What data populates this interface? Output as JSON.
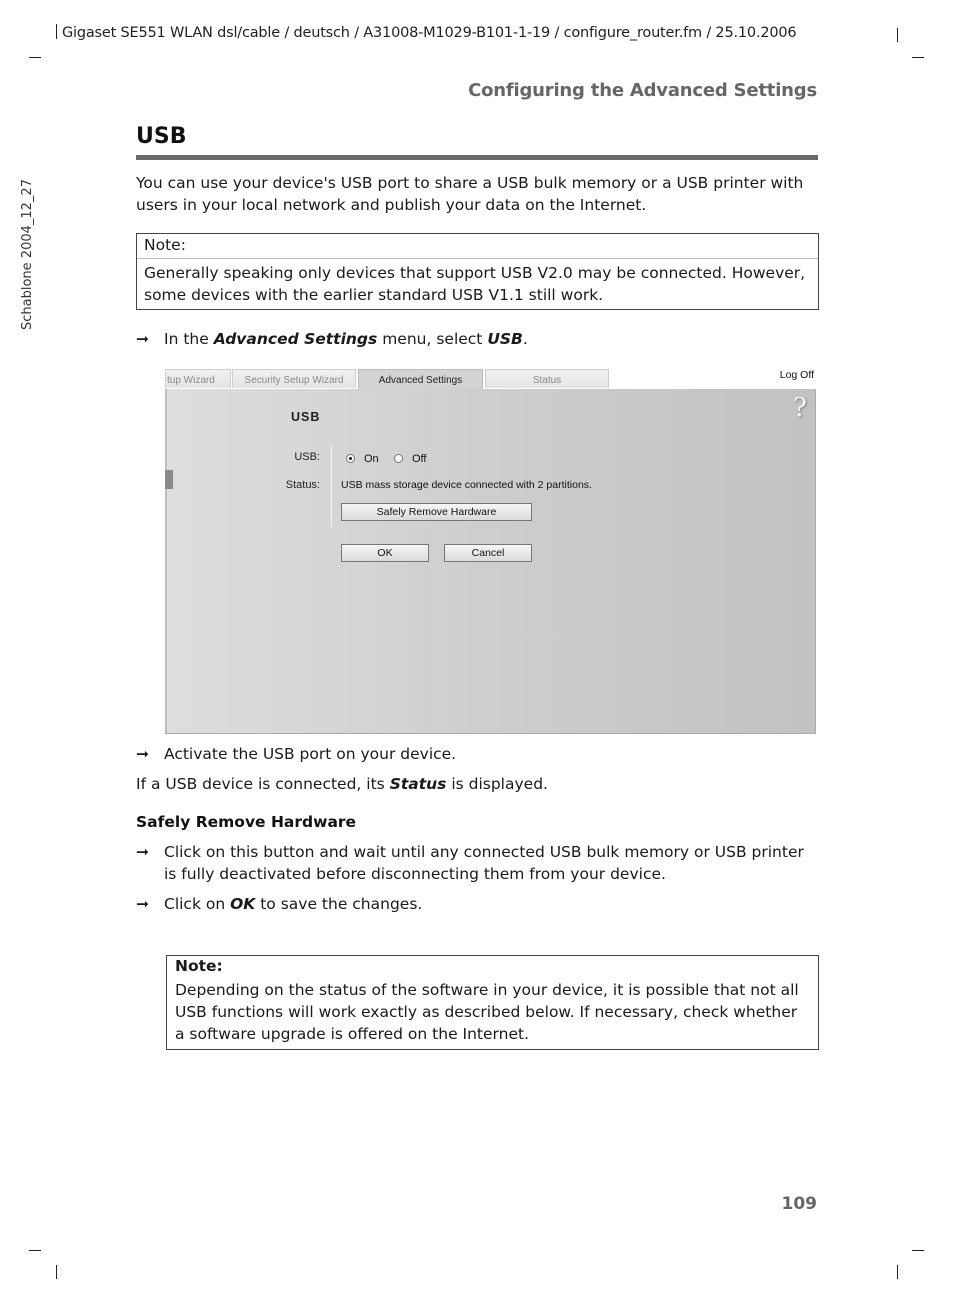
{
  "header": {
    "running_header": "Gigaset SE551 WLAN dsl/cable / deutsch / A31008-M1029-B101-1-19 / configure_router.fm / 25.10.2006",
    "section_title": "Configuring the Advanced Settings",
    "side_label": "Schablone 2004_12_27"
  },
  "page": {
    "title": "USB",
    "intro": "You can use your device's USB port to share a USB bulk memory or a USB printer with users in your local network and publish your data on the Internet.",
    "note1": {
      "label": "Note:",
      "text": "Generally speaking only devices that support USB V2.0 may be connected. However, some devices with the earlier standard USB V1.1 still work."
    },
    "step1": {
      "arrow": "➞",
      "prefix": "In the ",
      "em1": "Advanced Settings",
      "middle": " menu, select ",
      "em2": "USB",
      "suffix": "."
    },
    "step2": {
      "arrow": "➞",
      "text": "Activate the USB port on your device."
    },
    "status_line": {
      "prefix": "If a USB device is connected, its ",
      "em": "Status",
      "suffix": " is displayed."
    },
    "subheading": "Safely Remove Hardware",
    "step3": {
      "arrow": "➞",
      "text": "Click on this button and wait until any connected USB bulk memory or USB printer is fully deactivated before disconnecting them from your device."
    },
    "step4": {
      "arrow": "➞",
      "prefix": "Click on ",
      "em": "OK",
      "suffix": " to save the changes."
    },
    "note2": {
      "label": "Note:",
      "text": "Depending on the status of the software in your device, it is possible that not all USB functions will work exactly as described below. If necessary, check whether a software upgrade is offered on the Internet."
    },
    "page_number": "109"
  },
  "screenshot": {
    "tabs": [
      {
        "label": "tup Wizard",
        "active": false
      },
      {
        "label": "Security Setup Wizard",
        "active": false
      },
      {
        "label": "Advanced Settings",
        "active": true
      },
      {
        "label": "Status",
        "active": false
      }
    ],
    "logoff": "Log Off",
    "help_icon": "?",
    "panel_title": "USB",
    "usb_label": "USB:",
    "usb_options": [
      {
        "label": "On",
        "selected": true
      },
      {
        "label": "Off",
        "selected": false
      }
    ],
    "status_label": "Status:",
    "status_value": "USB mass storage device connected with 2 partitions.",
    "safely_remove_button": "Safely Remove Hardware",
    "ok_button": "OK",
    "cancel_button": "Cancel"
  }
}
